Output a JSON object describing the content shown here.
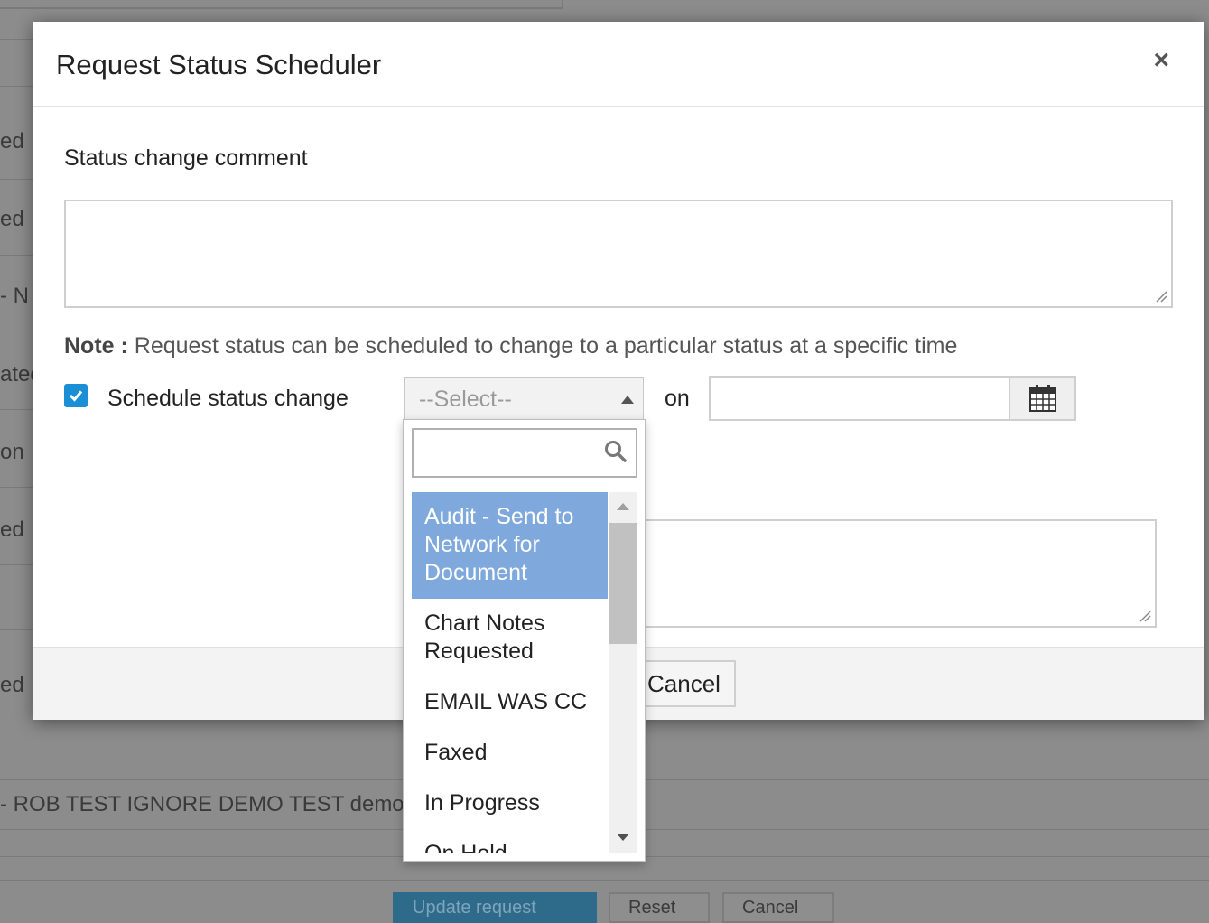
{
  "background": {
    "row_fragments": [
      "ed",
      "ed",
      "- N",
      "ated",
      "on",
      "ed",
      "ed"
    ],
    "row_text": "- ROB TEST IGNORE DEMO TEST demo",
    "buttons": [
      "Update request",
      "Reset",
      "Cancel"
    ]
  },
  "modal": {
    "title": "Request Status Scheduler",
    "close_label": "×",
    "comment_label": "Status change comment",
    "comment_value": "",
    "note_label": "Note :",
    "note_text": " Request status can be scheduled to change to a particular status at a specific time",
    "schedule_checked": true,
    "schedule_label": "Schedule status change",
    "select_placeholder": "--Select--",
    "on_label": "on",
    "date_value": "",
    "second_textarea_value": "",
    "cancel_label": "Cancel"
  },
  "dropdown": {
    "search_value": "",
    "items": [
      {
        "label": "Audit - Send to Network for Document",
        "highlighted": true
      },
      {
        "label": "Chart Notes Requested",
        "highlighted": false
      },
      {
        "label": "EMAIL WAS CC",
        "highlighted": false
      },
      {
        "label": "Faxed",
        "highlighted": false
      },
      {
        "label": "In Progress",
        "highlighted": false
      },
      {
        "label": "On Hold",
        "highlighted": false
      }
    ]
  },
  "colors": {
    "highlight": "#7fa9dc",
    "checkbox": "#1a8fd6",
    "overlay": "#8c8c8c"
  },
  "icons": {
    "close": "close-icon",
    "calendar": "calendar-icon",
    "search": "search-icon",
    "check": "checkmark-icon"
  }
}
